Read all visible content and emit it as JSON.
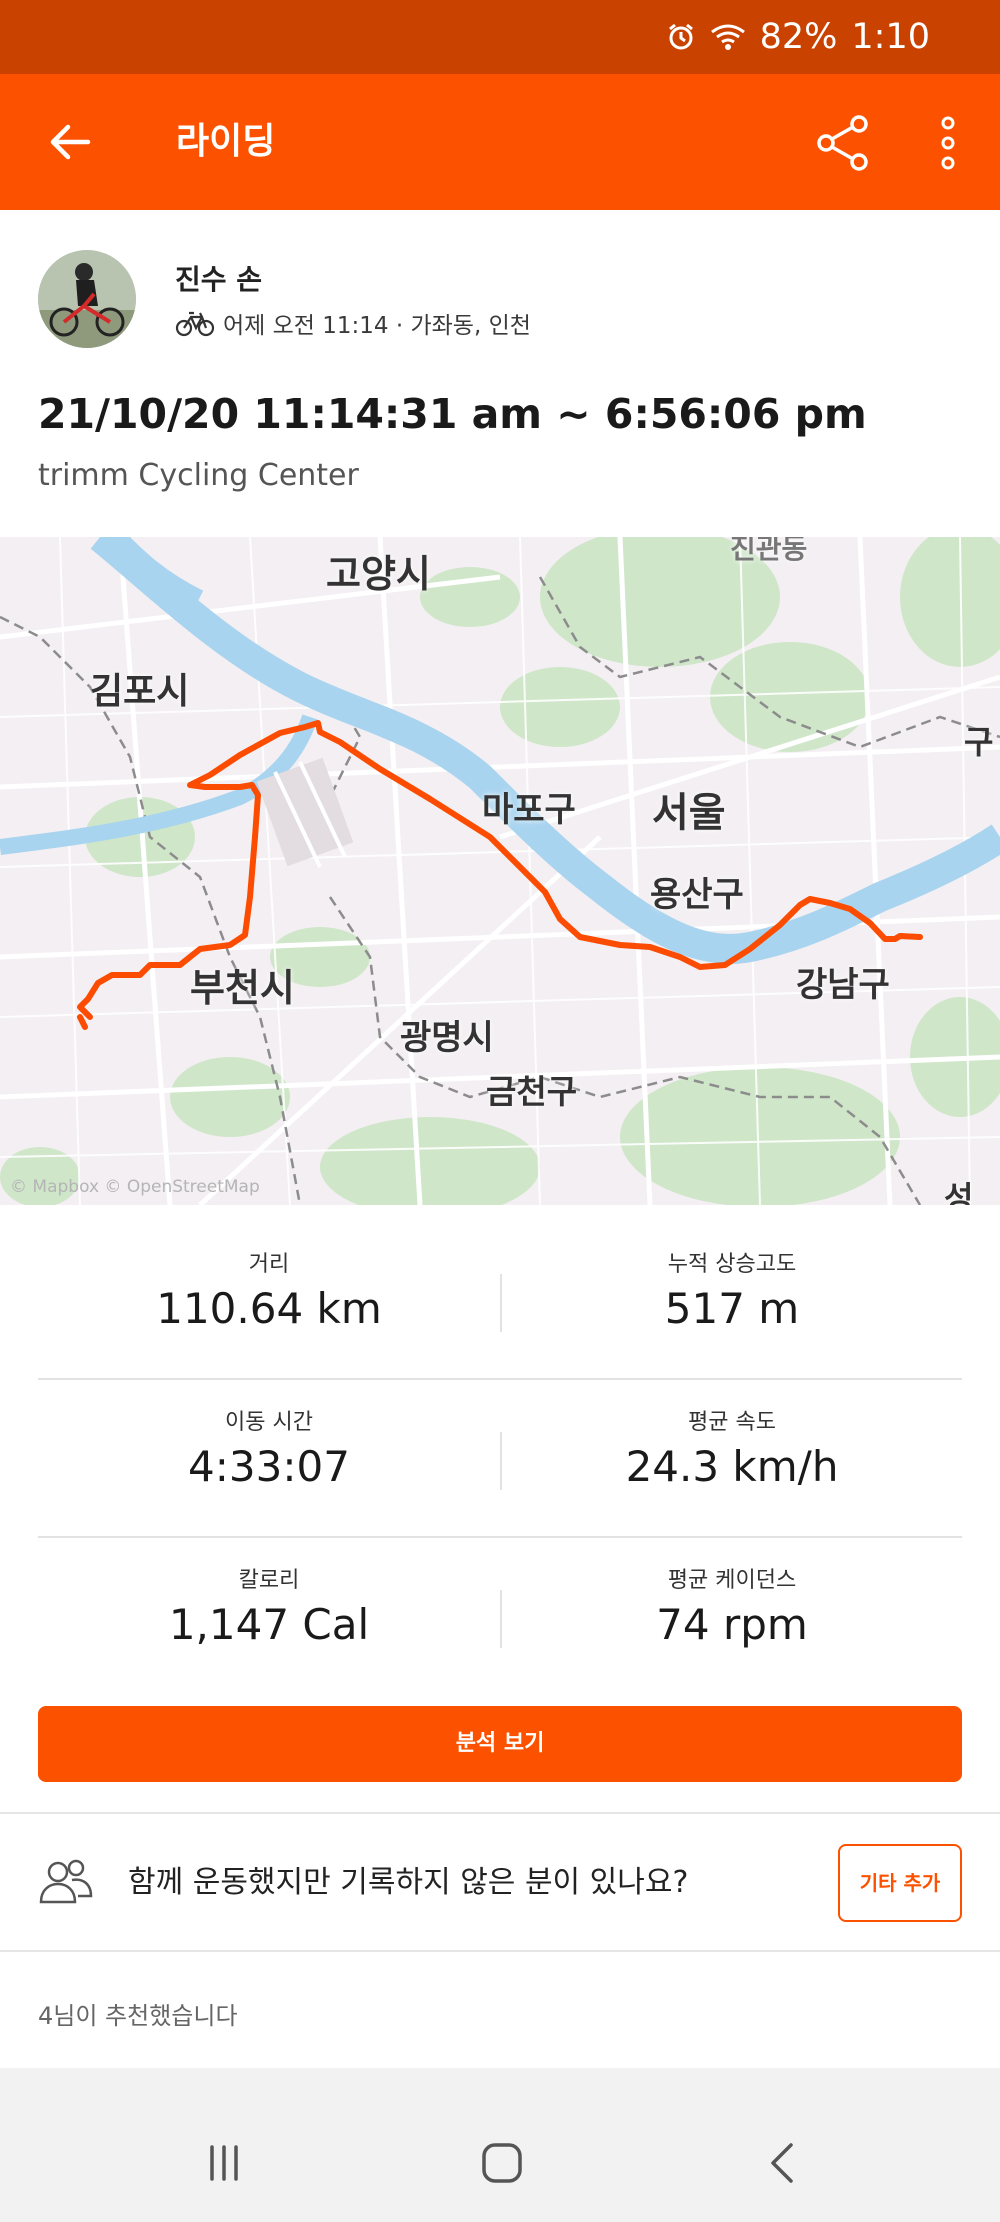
{
  "status_bar": {
    "battery": "82%",
    "time": "1:10"
  },
  "app_bar": {
    "title": "라이딩"
  },
  "athlete": {
    "name": "진수 손",
    "meta": "어제 오전 11:14 · 가좌동, 인천"
  },
  "activity": {
    "title": "21/10/20 11:14:31 am ~ 6:56:06 pm",
    "description": "trimm Cycling Center"
  },
  "map": {
    "labels": {
      "goyang": "고양시",
      "gimpo": "김포시",
      "mapo": "마포구",
      "seoul": "서울",
      "yongsan": "용산구",
      "bucheon": "부천시",
      "gwangmyeong": "광명시",
      "geumcheon": "금천구",
      "gangnam": "강남구",
      "top_right": "진관동",
      "right_edge": "구",
      "bottom_right": "성남"
    },
    "attribution": "© Mapbox © OpenStreetMap",
    "route_color": "#fc4c02"
  },
  "stats": [
    [
      {
        "label": "거리",
        "value": "110.64 km"
      },
      {
        "label": "누적 상승고도",
        "value": "517 m"
      }
    ],
    [
      {
        "label": "이동 시간",
        "value": "4:33:07"
      },
      {
        "label": "평균 속도",
        "value": "24.3 km/h"
      }
    ],
    [
      {
        "label": "칼로리",
        "value": "1,147 Cal"
      },
      {
        "label": "평균 케이던스",
        "value": "74 rpm"
      }
    ]
  ],
  "analysis_button": "분석 보기",
  "group": {
    "question": "함께 운동했지만 기록하지 않은 분이 있나요?",
    "add_button": "기타 추가"
  },
  "kudos": "4님이 추천했습니다",
  "colors": {
    "brand": "#fc5200",
    "status_bar": "#c94200"
  }
}
